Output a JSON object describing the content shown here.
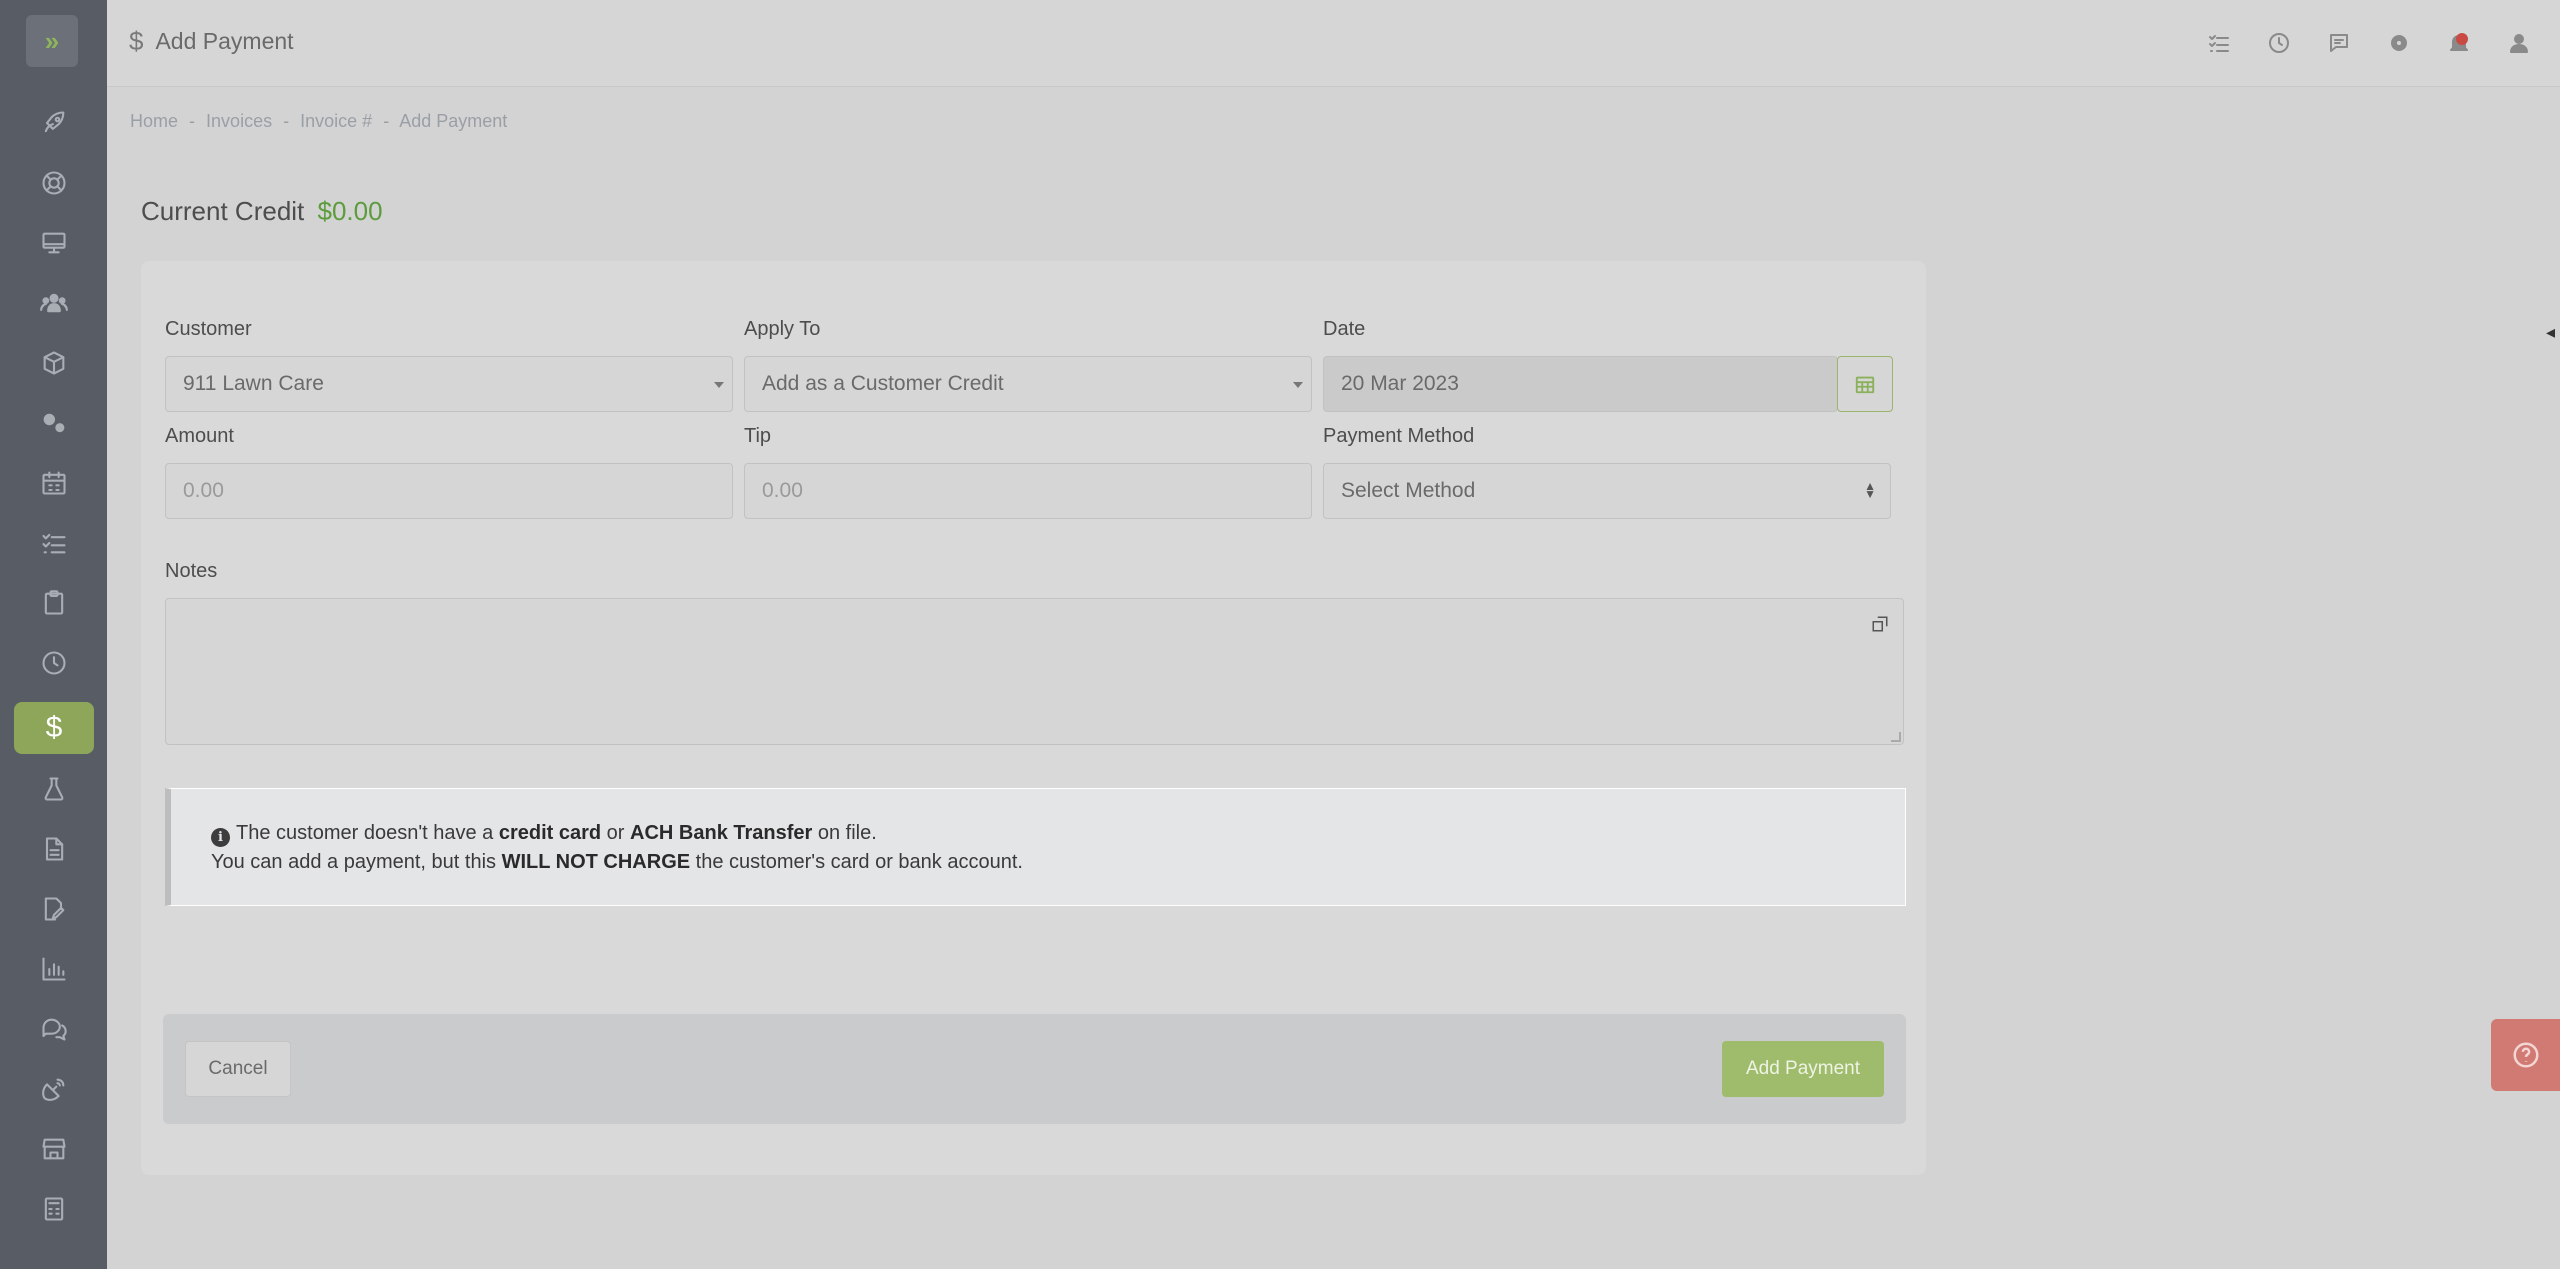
{
  "header": {
    "title": "Add Payment",
    "icons": [
      "tasks-icon",
      "clock-icon",
      "chat-icon",
      "gear-icon",
      "notification-icon",
      "user-icon"
    ]
  },
  "breadcrumb": [
    "Home",
    "-",
    "Invoices",
    "-",
    "Invoice #",
    "-",
    "Add Payment"
  ],
  "credit": {
    "label": "Current Credit",
    "amount": "$0.00"
  },
  "form": {
    "customer": {
      "label": "Customer",
      "value": "911 Lawn Care"
    },
    "apply_to": {
      "label": "Apply To",
      "value": "Add as a Customer Credit"
    },
    "date": {
      "label": "Date",
      "value": "20 Mar 2023"
    },
    "amount": {
      "label": "Amount",
      "placeholder": "0.00"
    },
    "tip": {
      "label": "Tip",
      "placeholder": "0.00"
    },
    "payment_method": {
      "label": "Payment Method",
      "value": "Select Method"
    },
    "notes": {
      "label": "Notes",
      "value": ""
    }
  },
  "alert": {
    "line1_a": "The customer doesn't have a ",
    "line1_b": "credit card",
    "line1_c": " or ",
    "line1_d": "ACH Bank Transfer",
    "line1_e": " on file.",
    "line2_a": "You can add a payment, but this ",
    "line2_b": "WILL NOT CHARGE",
    "line2_c": " the customer's card or bank account."
  },
  "buttons": {
    "cancel": "Cancel",
    "add_payment": "Add Payment"
  },
  "sidebar": {
    "items": [
      "rocket-icon",
      "support-icon",
      "monitor-icon",
      "team-icon",
      "box-icon",
      "gears-icon",
      "calendar-icon",
      "checklist-icon",
      "clipboard-icon",
      "clock-icon",
      "dollar-icon",
      "flask-icon",
      "document-icon",
      "edit-icon",
      "chart-icon",
      "comments-icon",
      "satellite-icon",
      "store-icon",
      "calculator-icon"
    ],
    "active": "dollar-icon"
  },
  "colors": {
    "accent": "#8ea65a",
    "credit_amount": "#5c9c3c",
    "help": "#d07a73"
  }
}
